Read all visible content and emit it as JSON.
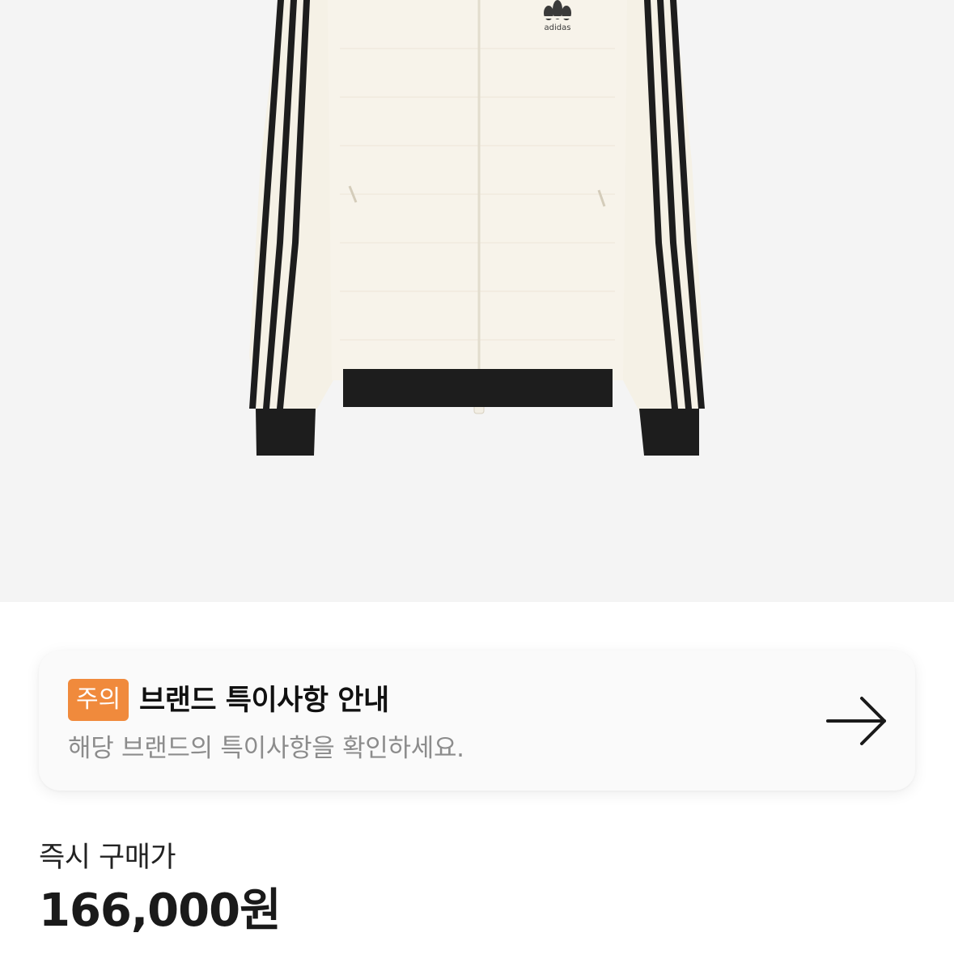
{
  "product": {
    "image_alt": "product-photo-white-track-jacket",
    "logo_text": "adidas"
  },
  "notice": {
    "badge": "주의",
    "title": "브랜드 특이사항 안내",
    "subtitle": "해당 브랜드의 특이사항을 확인하세요.",
    "arrow_icon": "arrow-right-icon"
  },
  "price": {
    "label": "즉시 구매가",
    "value": "166,000원"
  },
  "colors": {
    "badge": "#f08a3c",
    "image_background": "#f4f4f4"
  }
}
